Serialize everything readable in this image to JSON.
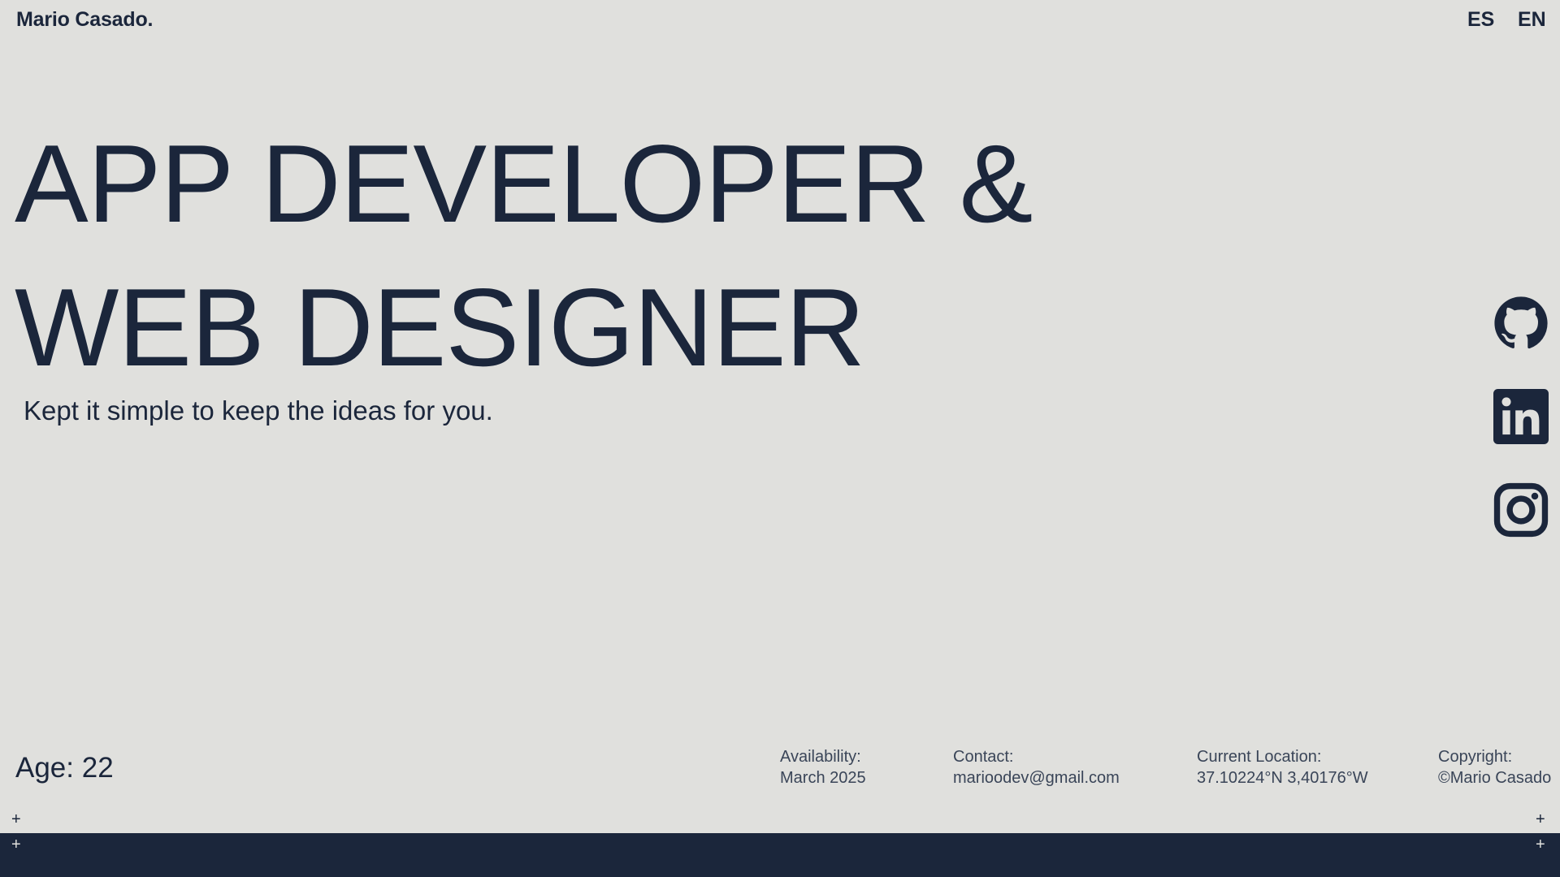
{
  "header": {
    "brand": "Mario Casado.",
    "lang_es": "ES",
    "lang_en": "EN"
  },
  "hero": {
    "line1": "APP DEVELOPER &",
    "line2": "WEB DESIGNER",
    "tagline": "Kept it simple to keep the ideas for you."
  },
  "social": {
    "icons": [
      "github-icon",
      "linkedin-icon",
      "instagram-icon"
    ]
  },
  "footer": {
    "age": "Age: 22",
    "availability_label": "Availability:",
    "availability_value": "March 2025",
    "contact_label": "Contact:",
    "contact_value": "marioodev@gmail.com",
    "location_label": "Current Location:",
    "location_value": "37.10224°N 3,40176°W",
    "copyright_label": "Copyright:",
    "copyright_value": "©Mario Casado",
    "plus": "+"
  },
  "colors": {
    "background": "#e0e0dd",
    "ink": "#1b263b"
  }
}
